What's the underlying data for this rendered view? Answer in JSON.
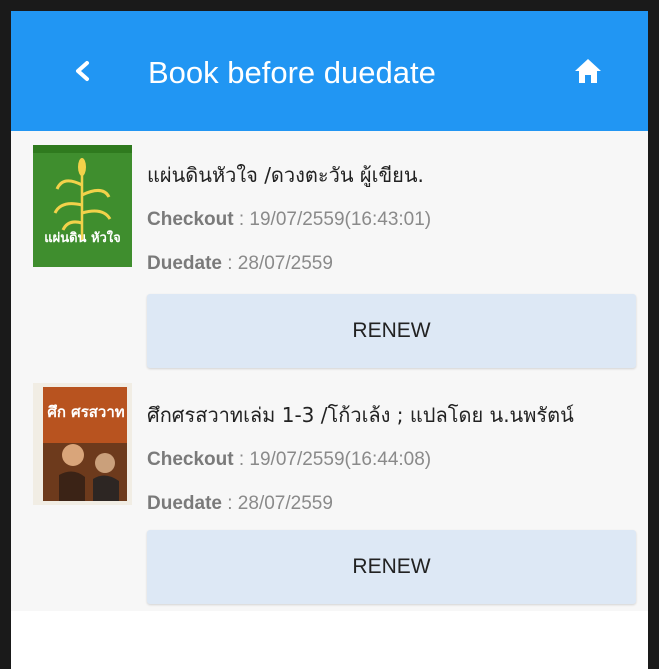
{
  "header": {
    "title": "Book before duedate",
    "back_icon": "chevron-left-icon",
    "home_icon": "home-icon",
    "bar_color": "#2196f3"
  },
  "books": [
    {
      "title": "แผ่นดินหัวใจ /ดวงตะวัน ผู้เขียน.",
      "checkout_label": "Checkout",
      "checkout_value": ": 19/07/2559(16:43:01)",
      "duedate_label": "Duedate",
      "duedate_value": ": 28/07/2559",
      "renew_label": "RENEW",
      "cover_text": "แผ่นดิน หัวใจ"
    },
    {
      "title": "ศึกศรสวาทเล่ม 1-3 /โก้วเล้ง ; แปลโดย น.นพรัตน์",
      "checkout_label": "Checkout",
      "checkout_value": ": 19/07/2559(16:44:08)",
      "duedate_label": "Duedate",
      "duedate_value": ": 28/07/2559",
      "renew_label": "RENEW",
      "cover_text": "ศึก ศรสวาท"
    }
  ]
}
